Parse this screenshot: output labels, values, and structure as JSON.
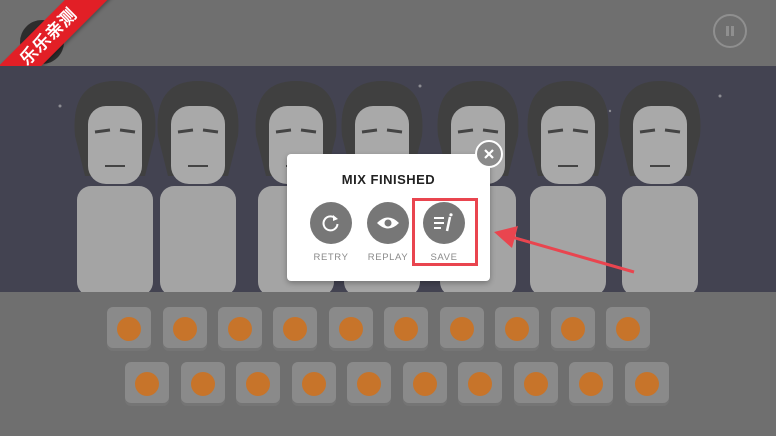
{
  "ribbon": {
    "text": "乐乐亲测"
  },
  "modal": {
    "title": "MIX FINISHED",
    "actions": [
      {
        "id": "retry",
        "label": "RETRY",
        "icon": "retry-icon"
      },
      {
        "id": "replay",
        "label": "REPLAY",
        "icon": "eye-icon"
      },
      {
        "id": "save",
        "label": "SAVE",
        "icon": "save-list-icon"
      }
    ]
  },
  "sound_icons_row1": [
    "gamepad-icon",
    "star-icon",
    "ring-icon",
    "onion-icon",
    "clock-icon",
    "leaf-icon",
    "sun-icon",
    "planet-icon",
    "coin-icon",
    "triangle-icon"
  ],
  "sound_icons_row2": [
    "balls-icon",
    "violin-icon",
    "ice-cream-icon",
    "guitar-icon",
    "maracas-icon",
    "butterfly-icon",
    "crate-icon",
    "tape-icon",
    "flower-icon",
    "crown-icon"
  ],
  "colors": {
    "accent_orange": "#c7742a",
    "highlight_red": "#e9454f",
    "ribbon_red": "#e21f26"
  }
}
